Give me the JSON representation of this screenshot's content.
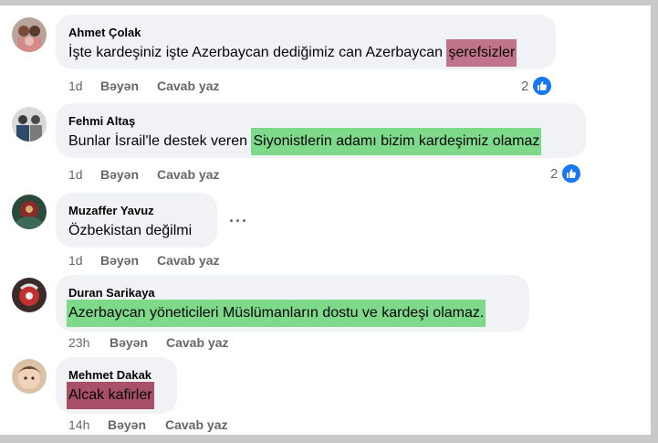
{
  "comments": [
    {
      "author": "Ahmet Çolak",
      "text_plain": "İşte kardeşiniz işte Azerbaycan dediğimiz can Azerbaycan ",
      "text_highlight": "şerefsizler",
      "time": "1d",
      "like_label": "Bəyən",
      "reply_label": "Cavab yaz",
      "reaction_count": "2"
    },
    {
      "author": "Fehmi Altaş",
      "text_plain": "Bunlar İsrail'le destek veren ",
      "text_highlight": "Siyonistlerin adamı bizim kardeşimiz olamaz",
      "time": "1d",
      "like_label": "Bəyən",
      "reply_label": "Cavab yaz",
      "reaction_count": "2"
    },
    {
      "author": "Muzaffer Yavuz",
      "text_plain": "Özbekistan değilmi",
      "more_label": "···",
      "time": "1d",
      "like_label": "Bəyən",
      "reply_label": "Cavab yaz"
    },
    {
      "author": "Duran Sarikaya",
      "text_highlight": "Azerbaycan yöneticileri Müslümanların dostu ve kardeşi olamaz.",
      "time": "23h",
      "like_label": "Bəyən",
      "reply_label": "Cavab yaz"
    },
    {
      "author": "Mehmet Dakak",
      "text_highlight": "Alcak kafirler",
      "time": "14h",
      "like_label": "Bəyən",
      "reply_label": "Cavab yaz"
    }
  ],
  "colors": {
    "highlight_red": "#c0738a",
    "highlight_green": "#7fd98a",
    "highlight_darkred": "#a85068",
    "bubble": "#f0f2f5",
    "like_blue": "#1877f2"
  },
  "icons": {
    "like": "thumbs-up-icon",
    "more": "more-options-icon"
  }
}
